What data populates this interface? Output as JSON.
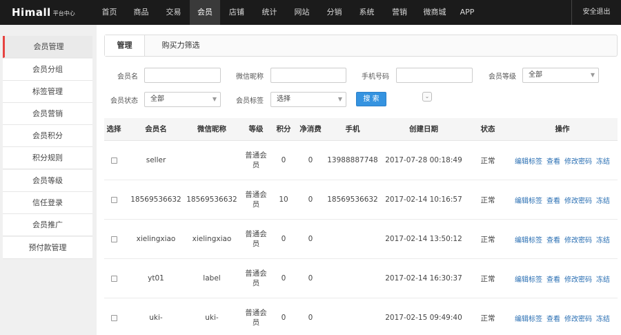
{
  "app": {
    "brand_text": "Himall",
    "brand_sub": "平台中心",
    "logout_label": "安全退出"
  },
  "nav": {
    "items": [
      {
        "label": "首页"
      },
      {
        "label": "商品"
      },
      {
        "label": "交易"
      },
      {
        "label": "会员"
      },
      {
        "label": "店铺"
      },
      {
        "label": "统计"
      },
      {
        "label": "网站"
      },
      {
        "label": "分销"
      },
      {
        "label": "系统"
      },
      {
        "label": "营销"
      },
      {
        "label": "微商城"
      },
      {
        "label": "APP"
      }
    ],
    "active_index": 3
  },
  "sidebar": {
    "items": [
      {
        "label": "会员管理"
      },
      {
        "label": "会员分组"
      },
      {
        "label": "标签管理"
      },
      {
        "label": "会员营销"
      },
      {
        "label": "会员积分"
      },
      {
        "label": "积分规则"
      },
      {
        "label": "会员等级"
      },
      {
        "label": "信任登录"
      },
      {
        "label": "会员推广"
      },
      {
        "label": "预付款管理"
      }
    ],
    "active_index": 0
  },
  "tabs": {
    "manage": "管理",
    "filter": "购买力筛选"
  },
  "filters": {
    "username_label": "会员名",
    "wechat_label": "微信昵称",
    "phone_label": "手机号码",
    "level_label": "会员等级",
    "level_value": "全部",
    "status_label": "会员状态",
    "status_value": "全部",
    "tag_label": "会员标签",
    "tag_value": "选择",
    "search_label": "搜 索",
    "expand_icon": "double-chevron-down-icon"
  },
  "table": {
    "headers": {
      "select": "选择",
      "username": "会员名",
      "wechat": "微信昵称",
      "level": "等级",
      "points": "积分",
      "net_spend": "净消费",
      "phone": "手机",
      "created": "创建日期",
      "status": "状态",
      "actions": "操作"
    },
    "action_labels": {
      "edit_tag": "编辑标签",
      "view": "查看",
      "change_password": "修改密码",
      "freeze": "冻结"
    },
    "rows": [
      {
        "username": "seller",
        "wechat": "",
        "level": "普通会员",
        "points": "0",
        "net_spend": "0",
        "phone": "13988887748",
        "created": "2017-07-28 00:18:49",
        "status": "正常"
      },
      {
        "username": "18569536632",
        "wechat": "18569536632",
        "level": "普通会员",
        "points": "10",
        "net_spend": "0",
        "phone": "18569536632",
        "created": "2017-02-14 10:16:57",
        "status": "正常"
      },
      {
        "username": "xielingxiao",
        "wechat": "xielingxiao",
        "level": "普通会员",
        "points": "0",
        "net_spend": "0",
        "phone": "",
        "created": "2017-02-14 13:50:12",
        "status": "正常"
      },
      {
        "username": "yt01",
        "wechat": "label",
        "level": "普通会员",
        "points": "0",
        "net_spend": "0",
        "phone": "",
        "created": "2017-02-14 16:30:37",
        "status": "正常"
      },
      {
        "username": "uki-",
        "wechat": "uki-",
        "level": "普通会员",
        "points": "0",
        "net_spend": "0",
        "phone": "",
        "created": "2017-02-15 09:49:40",
        "status": "正常"
      }
    ]
  },
  "colors": {
    "topbar": "#1b1b1b",
    "accent_red": "#e64340",
    "link_blue": "#2a6fb3",
    "button_blue": "#3593e0"
  }
}
